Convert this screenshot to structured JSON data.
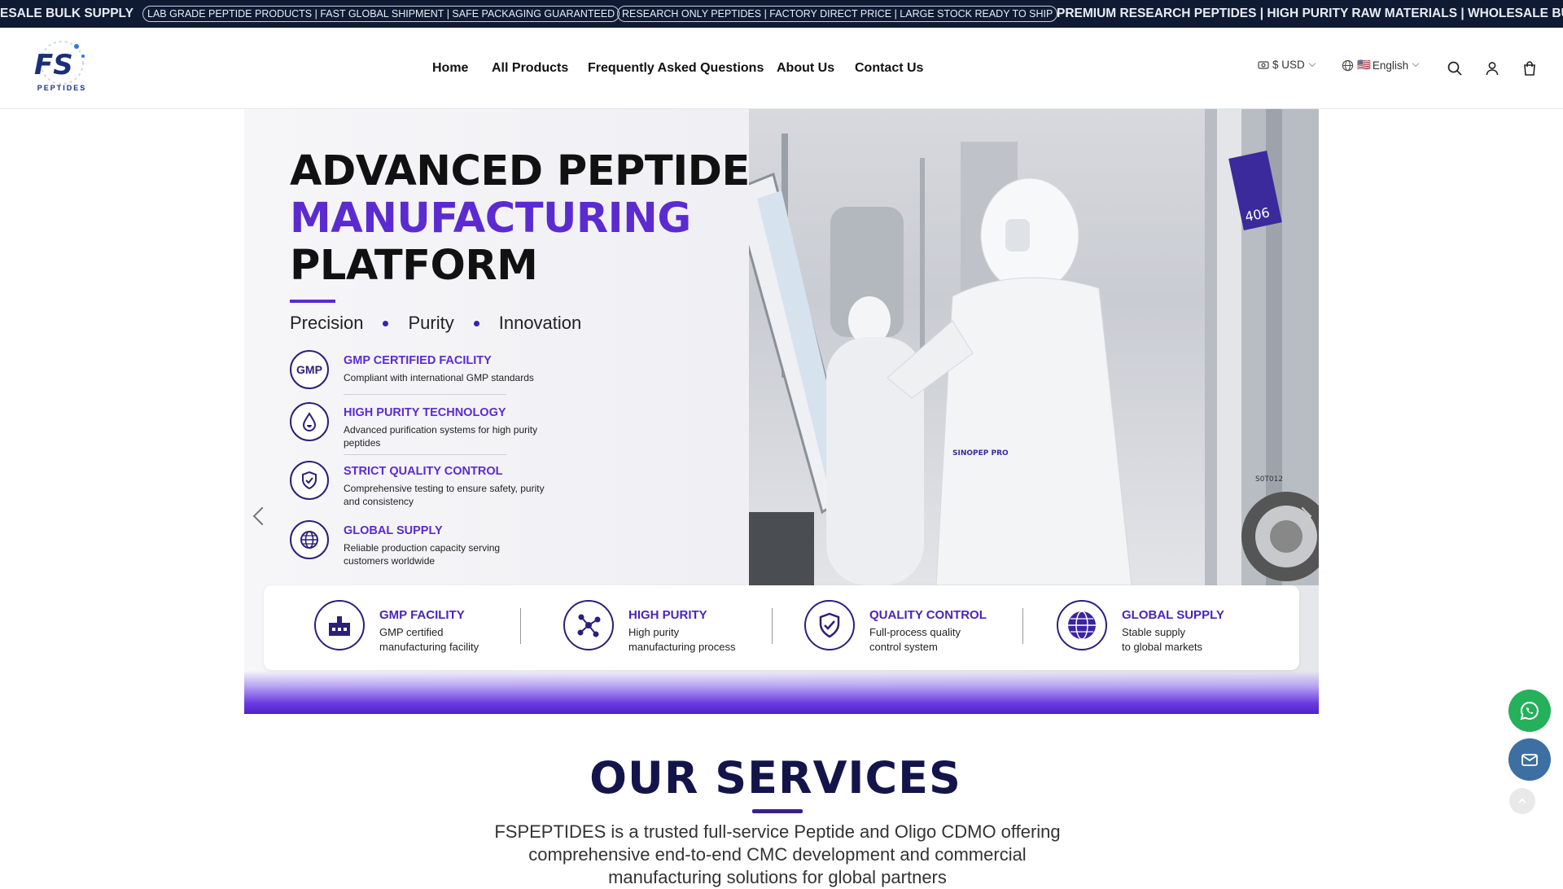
{
  "ticker": {
    "msg1": "ESALE BULK SUPPLY",
    "msg2": "LAB GRADE PEPTIDE PRODUCTS | FAST GLOBAL SHIPMENT | SAFE PACKAGING GUARANTEED",
    "msg3": "RESEARCH ONLY PEPTIDES | FACTORY DIRECT PRICE | LARGE STOCK READY TO SHIP",
    "msg4": "PREMIUM RESEARCH PEPTIDES | HIGH PURITY RAW MATERIALS | WHOLESALE BUL"
  },
  "header": {
    "logo_text": "PEPTIDES",
    "logo_mark": "FS",
    "nav": [
      "Home",
      "All Products",
      "Frequently Asked Questions",
      "About Us",
      "Contact Us"
    ],
    "currency": "$ USD",
    "language_flag": "🇺🇸",
    "language": "English",
    "icons": [
      "currency-icon",
      "globe-icon",
      "search-icon",
      "account-icon",
      "cart-icon"
    ]
  },
  "hero": {
    "title_line1": "ADVANCED PEPTIDE",
    "title_line2": "MANUFACTURING",
    "title_line3": "PLATFORM",
    "tagline": [
      "Precision",
      "Purity",
      "Innovation"
    ],
    "features": [
      {
        "title": "GMP CERTIFIED FACILITY",
        "desc": "Compliant with international GMP standards",
        "icon": "gmp-badge-icon",
        "badge": "GMP"
      },
      {
        "title": "HIGH PURITY TECHNOLOGY",
        "desc": "Advanced purification systems for high purity peptides",
        "icon": "droplet-icon"
      },
      {
        "title": "STRICT QUALITY CONTROL",
        "desc": "Comprehensive testing to ensure safety, purity and consistency",
        "icon": "shield-check-icon"
      },
      {
        "title": "GLOBAL SUPPLY",
        "desc": "Reliable production capacity serving customers worldwide",
        "icon": "globe-icon"
      }
    ],
    "bottom_features": [
      {
        "title": "GMP FACILITY",
        "line1": "GMP certified",
        "line2": "manufacturing facility",
        "icon": "factory-icon"
      },
      {
        "title": "HIGH PURITY",
        "line1": "High purity",
        "line2": "manufacturing process",
        "icon": "molecule-icon"
      },
      {
        "title": "QUALITY CONTROL",
        "line1": "Full-process quality",
        "line2": "control system",
        "icon": "shield-check-icon"
      },
      {
        "title": "GLOBAL SUPPLY",
        "line1": "Stable supply",
        "line2": "to global markets",
        "icon": "globe-icon"
      }
    ],
    "photo_text_1": "SINOPEP PRO",
    "photo_text_2": "S0T012",
    "photo_text_3": "406"
  },
  "services": {
    "title": "OUR SERVICES",
    "text": "FSPEPTIDES is a trusted full-service Peptide and Oligo CDMO offering comprehensive end-to-end CMC development and commercial manufacturing solutions for global partners"
  },
  "colors": {
    "accent": "#5b2bd1",
    "navy": "#13154a",
    "whatsapp": "#25b05a",
    "mail": "#3d6fa3"
  }
}
